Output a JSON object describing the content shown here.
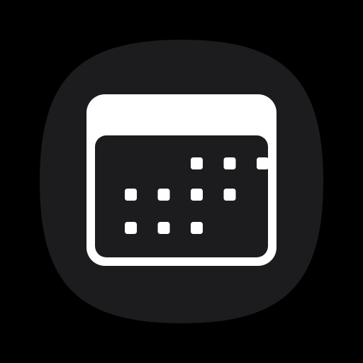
{
  "icon": {
    "name": "calendar-app-icon",
    "symbol": "calendar-icon",
    "colors": {
      "page_background": "#000000",
      "tile": "#1c1c1e",
      "glyph": "#ffffff",
      "grid_panel": "#1c1c1e"
    },
    "calendar": {
      "rows": [
        [
          false,
          false,
          true,
          true,
          true
        ],
        [
          true,
          true,
          true,
          true,
          false
        ],
        [
          true,
          true,
          true,
          false,
          false
        ]
      ]
    }
  }
}
